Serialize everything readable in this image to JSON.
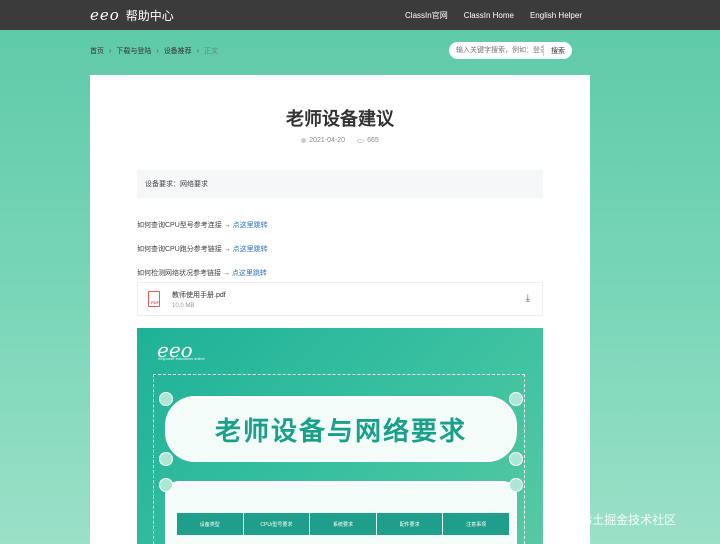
{
  "topbar": {
    "logo_mark": "eeo",
    "logo_text": "帮助中心",
    "nav": [
      "ClassIn官网",
      "ClassIn Home",
      "English Helper"
    ]
  },
  "breadcrumb": [
    "首页",
    "下载与登陆",
    "设备推荐",
    "正文"
  ],
  "search": {
    "placeholder": "输入关键字搜索，例如：登录",
    "button": "搜索"
  },
  "article": {
    "title": "老师设备建议",
    "date": "2021-04-20",
    "views": "665",
    "requirement": "设备要求：网络要求",
    "lines": [
      {
        "text": "如何查询CPU型号参考连接 → ",
        "link": "点这里跳转"
      },
      {
        "text": "如何查询CPU跑分参考链接 → ",
        "link": "点这里跳转"
      },
      {
        "text": "如何检测网络状况参考链接 → ",
        "link": "点这里跳转"
      }
    ],
    "attachment": {
      "name": "教师使用手册.pdf",
      "size": "10.0 MB"
    }
  },
  "poster": {
    "logo": "eeo",
    "tagline": "empower education online",
    "banner": "老师设备与网络要求",
    "table_headers": [
      "设备类型",
      "CPU/型号要求",
      "系统要求",
      "配件要求",
      "注意事项"
    ]
  },
  "watermark": "@稀土掘金技术社区",
  "colors": {
    "topbar": "#3b3b3b",
    "accent": "#1f9f8b",
    "link": "#2f6fb8"
  }
}
